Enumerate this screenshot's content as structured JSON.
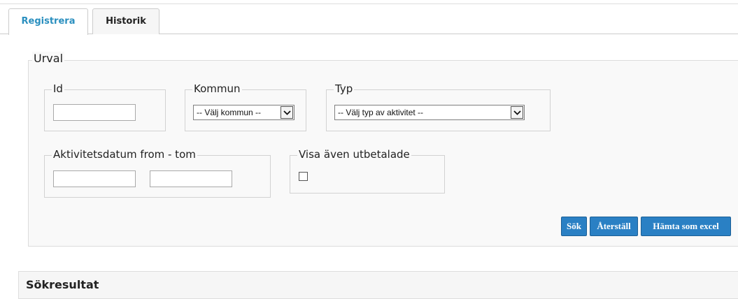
{
  "tabs": [
    {
      "label": "Registrera",
      "active": true
    },
    {
      "label": "Historik",
      "active": false
    }
  ],
  "urval": {
    "legend": "Urval",
    "id": {
      "legend": "Id",
      "value": ""
    },
    "kommun": {
      "legend": "Kommun",
      "selected": "-- Välj kommun --"
    },
    "typ": {
      "legend": "Typ",
      "selected": "-- Välj typ av aktivitet --"
    },
    "datum": {
      "legend": "Aktivitetsdatum from - tom",
      "from": "",
      "tom": ""
    },
    "utbetalade": {
      "legend": "Visa även utbetalade",
      "checked": false
    }
  },
  "buttons": {
    "sok": "Sök",
    "aterstall": "Återställ",
    "excel": "Hämta som excel"
  },
  "results": {
    "title": "Sökresultat"
  },
  "colors": {
    "accent": "#2a8fbf",
    "button": "#2a80c4"
  }
}
